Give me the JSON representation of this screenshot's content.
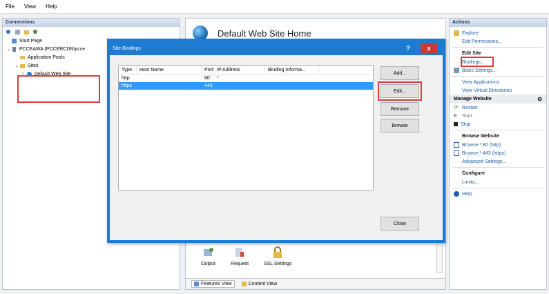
{
  "menu": [
    "File",
    "View",
    "Help"
  ],
  "connections": {
    "header": "Connections",
    "tree": [
      {
        "label": "Start Page",
        "level": 1
      },
      {
        "label": "PCCEAWA (PCCERCDN\\pcce",
        "level": 1
      },
      {
        "label": "Application Pools",
        "level": 2
      },
      {
        "label": "Sites",
        "level": 2
      },
      {
        "label": "Default Web Site",
        "level": 3
      }
    ]
  },
  "center": {
    "title": "Default Web Site Home",
    "features": [
      "Output",
      "Request",
      "SSL Settings"
    ],
    "tabs": [
      "Features View",
      "Content View"
    ]
  },
  "dialog": {
    "title": "Site Bindings",
    "help_label": "?",
    "close_label": "x",
    "columns": [
      "Type",
      "Host Name",
      "Port",
      "IP Address",
      "Binding Informa..."
    ],
    "rows": [
      {
        "type": "http",
        "host": "",
        "port": "80",
        "ip": "*",
        "info": ""
      },
      {
        "type": "https",
        "host": "",
        "port": "443",
        "ip": "",
        "info": ""
      }
    ],
    "buttons": {
      "add": "Add...",
      "edit": "Edit...",
      "remove": "Remove",
      "browse": "Browse",
      "close": "Close"
    }
  },
  "actions": {
    "header": "Actions",
    "explore": "Explore",
    "edit_permissions": "Edit Permissions...",
    "edit_site_head": "Edit Site",
    "bindings": "Bindings...",
    "basic_settings": "Basic Settings...",
    "view_applications": "View Applications",
    "view_virtual_dirs": "View Virtual Directories",
    "manage_website": "Manage Website",
    "restart": "Restart",
    "start": "Start",
    "stop": "Stop",
    "browse_website": "Browse Website",
    "browse_80": "Browse *:80 (http)",
    "browse_443": "Browse *:443 (https)",
    "advanced_settings": "Advanced Settings...",
    "configure": "Configure",
    "limits": "Limits...",
    "help": "Help"
  },
  "colors": {
    "accent": "#1e7bd2",
    "highlight_box": "#e0393c",
    "selection": "#3399ff",
    "link": "#1f5fa8"
  }
}
